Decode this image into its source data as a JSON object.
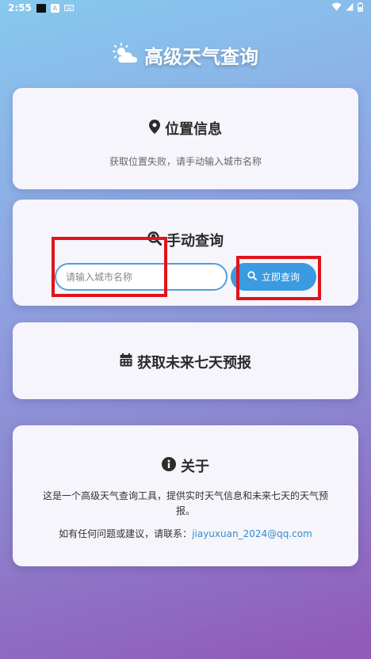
{
  "status_bar": {
    "time": "2:55",
    "icons": [
      "notification-black-square",
      "a-badge",
      "keyboard-icon",
      "wifi-icon",
      "signal-icon",
      "battery-icon"
    ]
  },
  "app": {
    "title": "高级天气查询",
    "title_icon": "cloud-sun-icon"
  },
  "location_card": {
    "title": "位置信息",
    "icon": "map-pin-icon",
    "message": "获取位置失败，请手动输入城市名称"
  },
  "search_card": {
    "title": "手动查询",
    "icon": "search-location-icon",
    "input_placeholder": "请输入城市名称",
    "input_value": "",
    "button_label": "立即查询",
    "button_icon": "search-icon"
  },
  "forecast_card": {
    "title": "获取未来七天预报",
    "icon": "calendar-icon"
  },
  "about_card": {
    "title": "关于",
    "icon": "info-circle-icon",
    "description": "这是一个高级天气查询工具，提供实时天气信息和未来七天的天气预报。",
    "contact_prefix": "如有任何问题或建议，请联系：",
    "contact_email": "jiayuxuan_2024@qq.com"
  },
  "colors": {
    "accent": "#3a9be0",
    "highlight_box": "#e0141b",
    "card_bg": "#f6f5fb"
  }
}
